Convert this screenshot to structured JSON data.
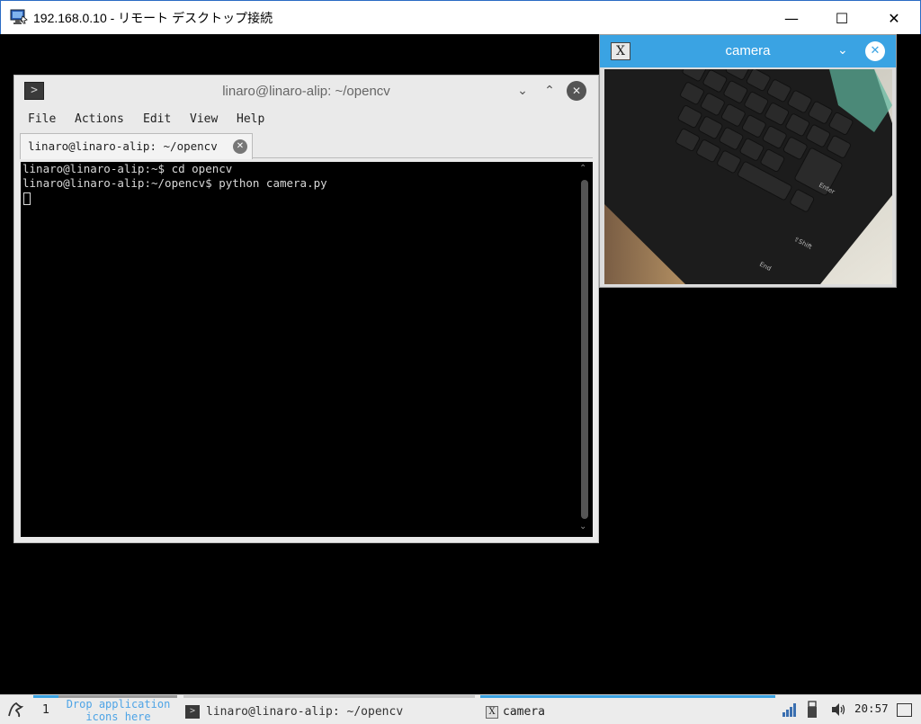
{
  "rdp": {
    "title": "192.168.0.10 - リモート デスクトップ接続",
    "minimize": "—",
    "maximize": "☐",
    "close": "✕"
  },
  "terminal": {
    "title": "linaro@linaro-alip: ~/opencv",
    "app_icon": ">",
    "shade": "⌄",
    "maximize": "⌃",
    "close": "✕",
    "menu": [
      "File",
      "Actions",
      "Edit",
      "View",
      "Help"
    ],
    "tab_label": "linaro@linaro-alip: ~/opencv",
    "lines": [
      "linaro@linaro-alip:~$ cd opencv",
      "linaro@linaro-alip:~/opencv$ python camera.py"
    ]
  },
  "camera": {
    "title": "camera",
    "app_icon": "X",
    "shade": "⌄",
    "close": "✕"
  },
  "taskbar": {
    "desktop_number": "1",
    "drop_text_1": "Drop application",
    "drop_text_2": "icons here",
    "task_terminal": "linaro@linaro-alip: ~/opencv",
    "task_terminal_icon": ">",
    "task_camera": "camera",
    "task_camera_icon": "X",
    "clock": "20:57"
  },
  "colors": {
    "accent": "#3aa3e3",
    "terminal_bg": "#000000",
    "terminal_text": "#d8d8d8"
  }
}
